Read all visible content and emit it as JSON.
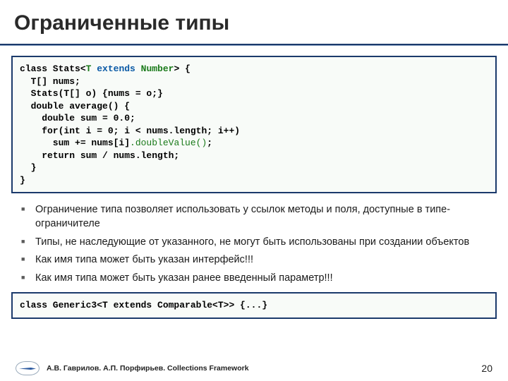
{
  "title": "Ограниченные типы",
  "code1": {
    "l1a": "class Stats<",
    "l1b": "T",
    "l1c": " extends ",
    "l1d": "Number",
    "l1e": "> {",
    "l2": "  T[] nums;",
    "l3": "  Stats(T[] o) {nums = o;}",
    "l4": "  double average() {",
    "l5": "    double sum = 0.0;",
    "l6": "    for(int i = 0; i < nums.length; i++)",
    "l7a": "      sum += nums[i]",
    "l7b": ".doubleValue()",
    "l7c": ";",
    "l8": "    return sum / nums.length;",
    "l9": "  }",
    "l10": "}"
  },
  "bullets": [
    "Ограничение типа позволяет использовать у ссылок методы и поля, доступные в типе-ограничителе",
    "Типы, не наследующие от указанного, не могут быть использованы при создании объектов",
    "Как имя типа может быть указан интерфейс!!!",
    "Как имя типа может быть указан ранее введенный параметр!!!"
  ],
  "code2": "class Generic3<T extends Comparable<T>> {...}",
  "footer": "А.В. Гаврилов. А.П. Порфирьев. Collections Framework",
  "page": "20"
}
